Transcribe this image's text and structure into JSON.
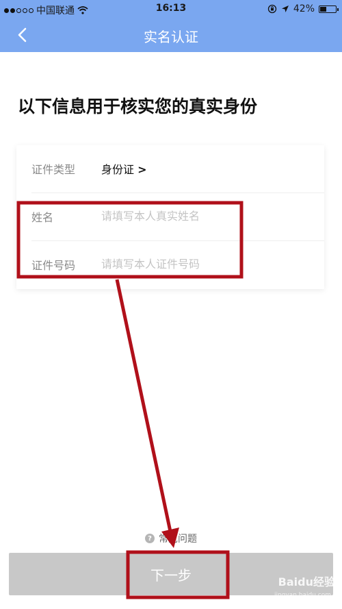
{
  "status_bar": {
    "carrier": "中国联通",
    "time": "16:13",
    "battery": "42%",
    "battery_level": 0.42,
    "signal_bars_filled": 2,
    "icons": [
      "signal-icon",
      "wifi-icon",
      "lock-rotation-icon",
      "location-arrow-icon",
      "battery-icon"
    ]
  },
  "header": {
    "title": "实名认证",
    "back_icon": "back-chevron-icon",
    "color": "#7aa7f0"
  },
  "main": {
    "headline": "以下信息用于核实您的真实身份"
  },
  "form": {
    "id_type": {
      "label": "证件类型",
      "value": "身份证",
      "chevron": ">"
    },
    "name": {
      "label": "姓名",
      "placeholder": "请填写本人真实姓名",
      "value": ""
    },
    "id_number": {
      "label": "证件号码",
      "placeholder": "请填写本人证件号码",
      "value": ""
    }
  },
  "help": {
    "label": "常见问题",
    "icon": "question-circle-icon"
  },
  "footer": {
    "next_label": "下一步",
    "button_color": "#c8c8c8"
  },
  "annotation": {
    "color": "#b0101a"
  },
  "watermark": {
    "brand": "Baidu经验",
    "url": "jingyan.baidu.com"
  }
}
